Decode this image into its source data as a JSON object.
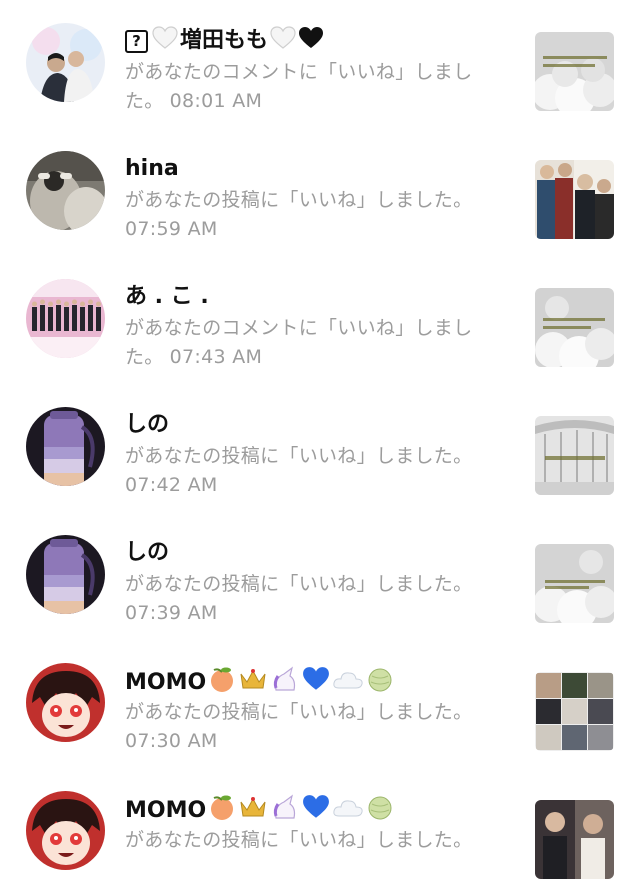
{
  "notifications": [
    {
      "name": "増田もも",
      "message": "があなたのコメントに「いいね」しました。",
      "time": "08:01 AM"
    },
    {
      "name": "hina",
      "message": "があなたの投稿に「いいね」しました。",
      "time": "07:59 AM"
    },
    {
      "name": "あ . こ .",
      "message": "があなたのコメントに「いいね」しました。",
      "time": "07:43 AM"
    },
    {
      "name": "しの",
      "message": "があなたの投稿に「いいね」しました。",
      "time": "07:42 AM"
    },
    {
      "name": "しの",
      "message": "があなたの投稿に「いいね」しました。",
      "time": "07:39 AM"
    },
    {
      "name": "MOMO",
      "message": "があなたの投稿に「いいね」しました。",
      "time": "07:30 AM"
    },
    {
      "name": "MOMO",
      "message": "があなたの投稿に「いいね」しました。",
      "time": ""
    }
  ],
  "name_decorations": {
    "masuda_prefix": [
      "?",
      "white-heart"
    ],
    "masuda_suffix": [
      "white-heart",
      "black-heart"
    ],
    "momo_suffix": [
      "peach",
      "crown",
      "unicorn",
      "blue-heart",
      "cloud",
      "melon"
    ]
  },
  "colors": {
    "name_text": "#111111",
    "message_text": "#9c9c9c",
    "background": "#ffffff"
  }
}
